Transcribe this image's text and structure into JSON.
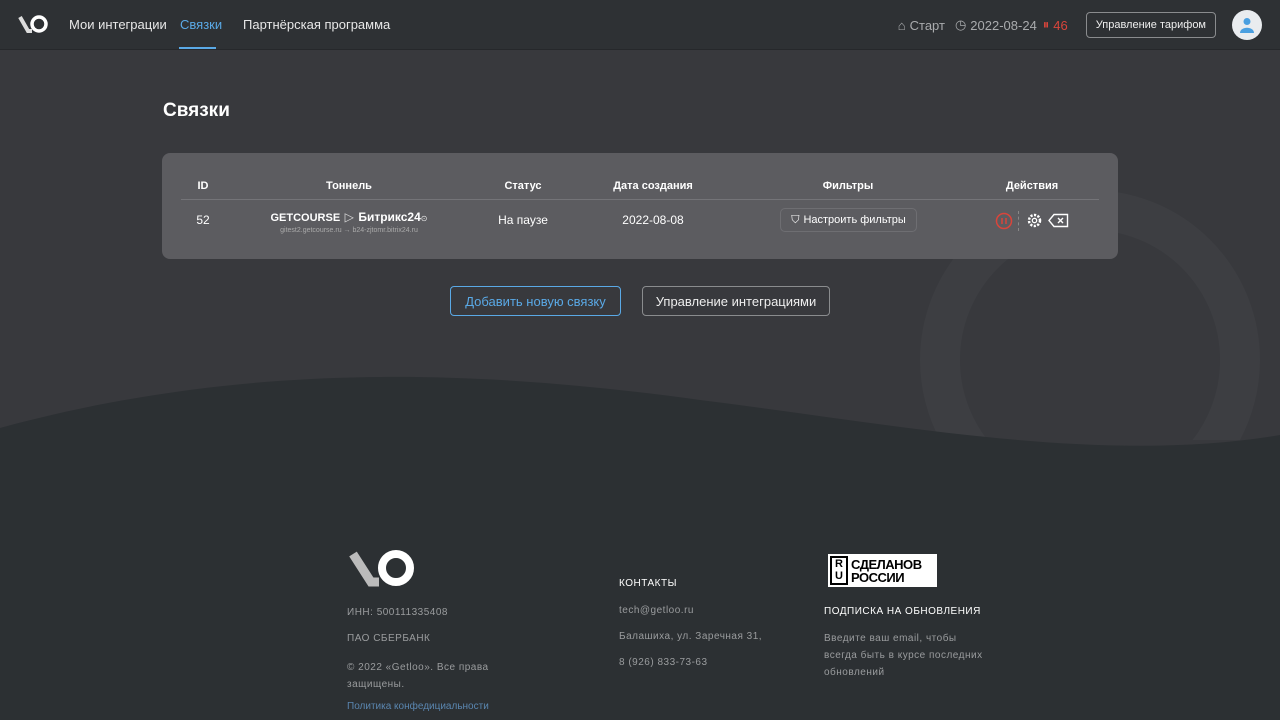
{
  "header": {
    "nav": [
      "Мои интеграции",
      "Связки",
      "Партнёрская программа"
    ],
    "plan": "Старт",
    "date": "2022-08-24",
    "days": "46",
    "tariff_button": "Управление тарифом"
  },
  "page": {
    "title": "Связки"
  },
  "table": {
    "headers": [
      "ID",
      "Тоннель",
      "Статус",
      "Дата создания",
      "Фильтры",
      "Действия"
    ],
    "rows": [
      {
        "id": "52",
        "from": "GETCOURSE",
        "to": "Битрикс24",
        "domains": "gitest2.getcourse.ru → b24-zjtomr.bitrix24.ru",
        "status": "На паузе",
        "created": "2022-08-08",
        "filter_button": "Настроить фильтры"
      }
    ]
  },
  "buttons": {
    "add": "Добавить новую связку",
    "manage": "Управление интеграциями"
  },
  "footer": {
    "inn": "ИНН: 500111335408",
    "bank": "ПАО СБЕРБАНК",
    "copyright": "© 2022 «Getloo». Все права защищены.",
    "privacy": "Политика конфедициальности",
    "contacts_title": "КОНТАКТЫ",
    "email": "tech@getloo.ru",
    "address": "Балашиха, ул. Заречная  31,",
    "phone": "8 (926) 833-73-63",
    "badge": "СДЕЛАНО В РОССИИ",
    "subscribe_title": "ПОДПИСКА НА ОБНОВЛЕНИЯ",
    "subscribe_text": "Введите ваш email, чтобы всегда быть в курсе последних обновлений"
  },
  "colors": {
    "accent": "#5aa9e6",
    "danger": "#d9453b"
  }
}
